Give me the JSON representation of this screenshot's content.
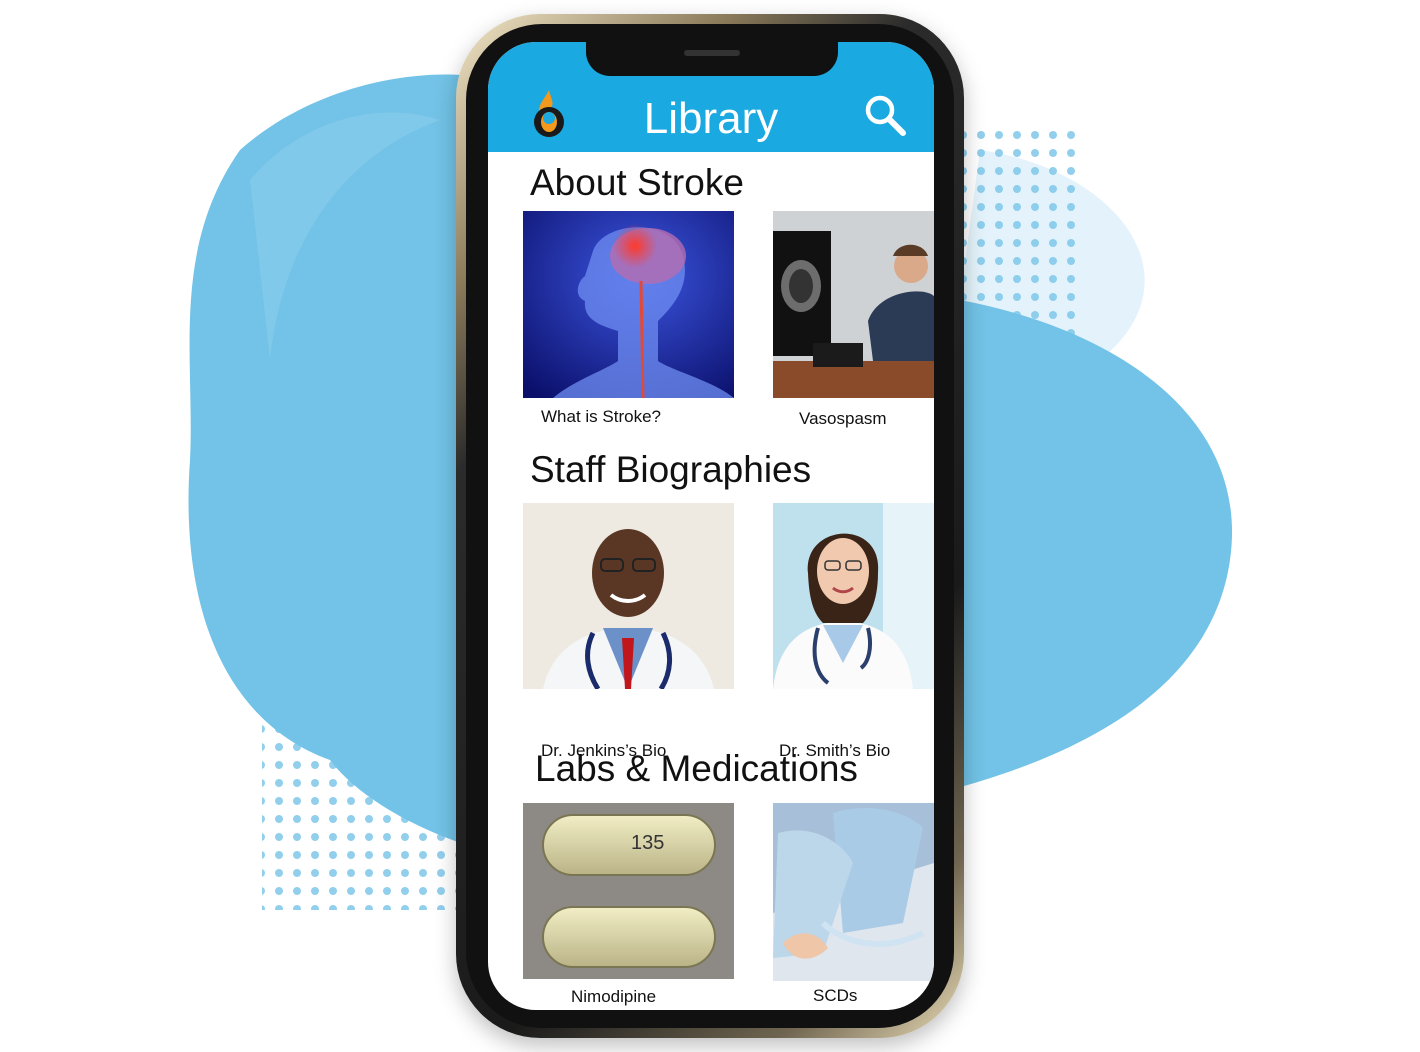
{
  "app": {
    "title": "Library",
    "header_color": "#1aa9e0",
    "logo_icon": "flame-logo-icon",
    "search_icon": "search-icon"
  },
  "sections": [
    {
      "title": "About Stroke",
      "items": [
        {
          "label": "What is Stroke?",
          "image": "brain-stroke-illustration"
        },
        {
          "label": "Vasospasm",
          "image": "doctor-at-ct-monitor-photo"
        }
      ]
    },
    {
      "title": "Staff Biographies",
      "items": [
        {
          "label": "Dr. Jenkins’s Bio",
          "image": "male-doctor-portrait"
        },
        {
          "label": "Dr. Smith’s Bio",
          "image": "female-doctor-portrait"
        }
      ]
    },
    {
      "title": "Labs & Medications",
      "items": [
        {
          "label": "Nimodipine",
          "image": "capsules-photo",
          "imprint": "135"
        },
        {
          "label": "SCDs",
          "image": "compression-devices-photo"
        }
      ]
    }
  ]
}
